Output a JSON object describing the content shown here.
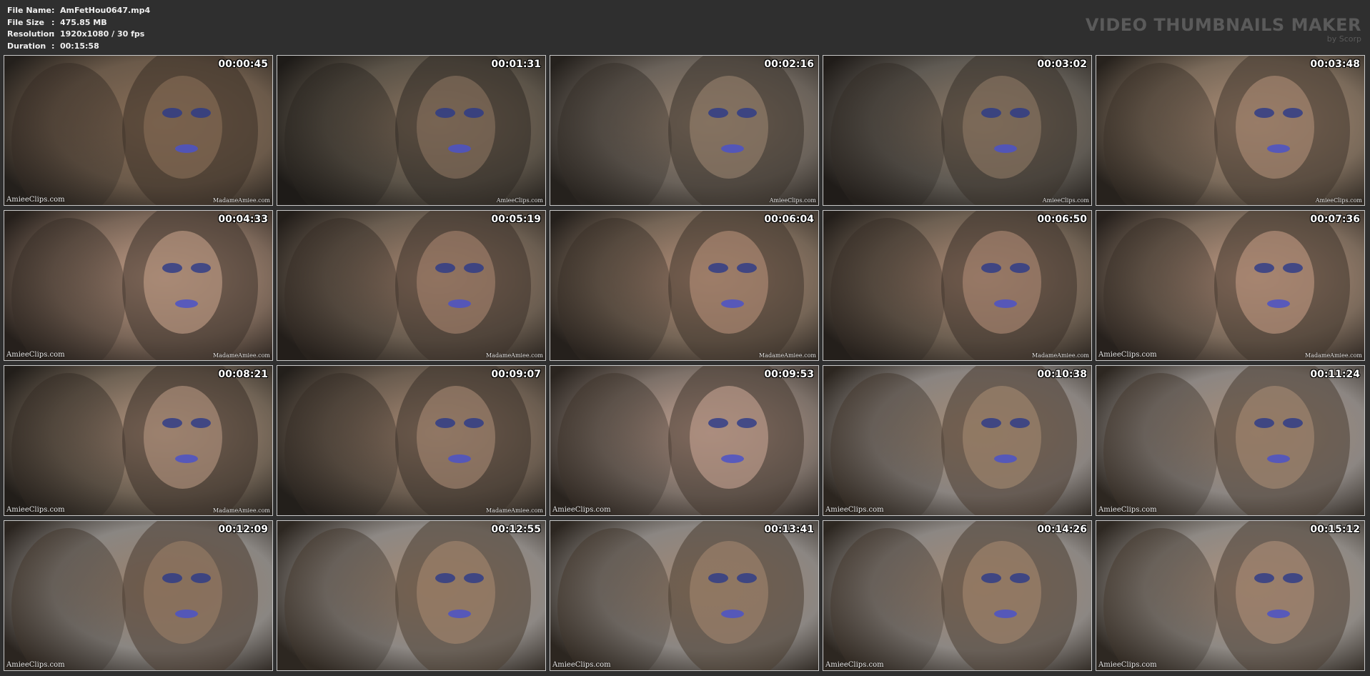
{
  "info": {
    "file_name_label": "File Name",
    "file_name": "AmFetHou0647.mp4",
    "file_size_label": "File Size",
    "file_size": "475.85 MB",
    "resolution_label": "Resolution",
    "resolution": "1920x1080 / 30 fps",
    "duration_label": "Duration",
    "duration": "00:15:58",
    "separator": ":"
  },
  "brand": {
    "title": "VIDEO THUMBNAILS MAKER",
    "subtitle": "by Scorp"
  },
  "thumbnails": [
    {
      "timestamp": "00:00:45",
      "watermark_left": "AmieeClips.com",
      "watermark_right": "MadameAmiee.com"
    },
    {
      "timestamp": "00:01:31",
      "watermark_left": "",
      "watermark_right": "AmieeClips.com"
    },
    {
      "timestamp": "00:02:16",
      "watermark_left": "",
      "watermark_right": "AmieeClips.com"
    },
    {
      "timestamp": "00:03:02",
      "watermark_left": "",
      "watermark_right": "AmieeClips.com"
    },
    {
      "timestamp": "00:03:48",
      "watermark_left": "",
      "watermark_right": "AmieeClips.com"
    },
    {
      "timestamp": "00:04:33",
      "watermark_left": "AmieeClips.com",
      "watermark_right": "MadameAmiee.com"
    },
    {
      "timestamp": "00:05:19",
      "watermark_left": "",
      "watermark_right": "MadameAmiee.com"
    },
    {
      "timestamp": "00:06:04",
      "watermark_left": "",
      "watermark_right": "MadameAmiee.com"
    },
    {
      "timestamp": "00:06:50",
      "watermark_left": "",
      "watermark_right": "MadameAmiee.com"
    },
    {
      "timestamp": "00:07:36",
      "watermark_left": "AmieeClips.com",
      "watermark_right": "MadameAmiee.com"
    },
    {
      "timestamp": "00:08:21",
      "watermark_left": "AmieeClips.com",
      "watermark_right": "MadameAmiee.com"
    },
    {
      "timestamp": "00:09:07",
      "watermark_left": "",
      "watermark_right": "MadameAmiee.com"
    },
    {
      "timestamp": "00:09:53",
      "watermark_left": "AmieeClips.com",
      "watermark_right": ""
    },
    {
      "timestamp": "00:10:38",
      "watermark_left": "AmieeClips.com",
      "watermark_right": ""
    },
    {
      "timestamp": "00:11:24",
      "watermark_left": "AmieeClips.com",
      "watermark_right": ""
    },
    {
      "timestamp": "00:12:09",
      "watermark_left": "AmieeClips.com",
      "watermark_right": ""
    },
    {
      "timestamp": "00:12:55",
      "watermark_left": "",
      "watermark_right": ""
    },
    {
      "timestamp": "00:13:41",
      "watermark_left": "AmieeClips.com",
      "watermark_right": ""
    },
    {
      "timestamp": "00:14:26",
      "watermark_left": "AmieeClips.com",
      "watermark_right": ""
    },
    {
      "timestamp": "00:15:12",
      "watermark_left": "AmieeClips.com",
      "watermark_right": ""
    }
  ]
}
